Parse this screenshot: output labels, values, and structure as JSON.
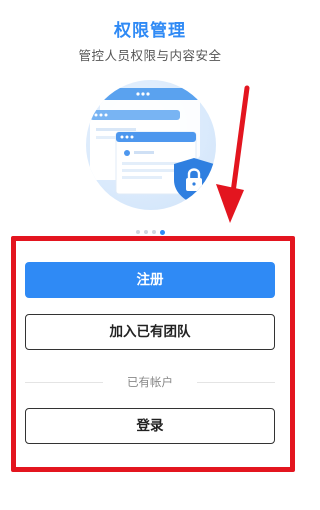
{
  "header": {
    "title": "权限管理",
    "subtitle": "管控人员权限与内容安全"
  },
  "carousel": {
    "page_count": 4,
    "active_index": 3
  },
  "actions": {
    "register_label": "注册",
    "join_team_label": "加入已有团队",
    "divider_text": "已有帐户",
    "login_label": "登录"
  },
  "colors": {
    "accent": "#2f8af5",
    "annotation": "#e3151f"
  },
  "icons": {
    "illustration": "lock-shield-icon"
  }
}
